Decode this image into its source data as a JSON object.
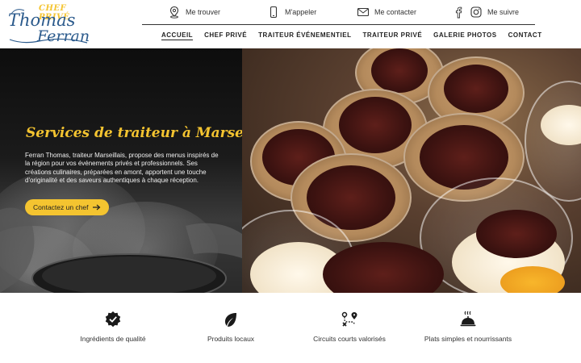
{
  "logo": {
    "top_text": "CHEF PRIVÉ",
    "line1": "Thomas",
    "line2": "Ferran"
  },
  "contact_bar": [
    {
      "label": "Me trouver",
      "icon": "map-pin-icon"
    },
    {
      "label": "M'appeler",
      "icon": "phone-icon"
    },
    {
      "label": "Me contacter",
      "icon": "envelope-icon"
    },
    {
      "label": "Me suivre",
      "icon": "social-icons"
    }
  ],
  "nav": [
    {
      "label": "ACCUEIL",
      "active": true
    },
    {
      "label": "CHEF PRIVÉ",
      "active": false
    },
    {
      "label": "TRAITEUR ÉVÉNEMENTIEL",
      "active": false
    },
    {
      "label": "TRAITEUR PRIVÉ",
      "active": false
    },
    {
      "label": "GALERIE PHOTOS",
      "active": false
    },
    {
      "label": "CONTACT",
      "active": false
    }
  ],
  "hero": {
    "title": "Services de traiteur à Marseille",
    "text": "Ferran Thomas, traiteur Marseillais, propose des menus inspirés de la région pour vos événements privés et professionnels. Ses créations culinaires, préparées en amont, apportent une touche d'originalité et des saveurs authentiques à chaque réception.",
    "button_label": "Contactez un chef",
    "button_icon": "arrow-right-icon"
  },
  "features": [
    {
      "label": "Ingrédients de qualité",
      "icon": "verified-badge-icon"
    },
    {
      "label": "Produits locaux",
      "icon": "leaf-icon"
    },
    {
      "label": "Circuits courts valorisés",
      "icon": "route-icon"
    },
    {
      "label": "Plats simples et nourrissants",
      "icon": "cloche-icon"
    }
  ],
  "colors": {
    "accent": "#f4c430",
    "brand_blue": "#2b5a8c",
    "text_dark": "#222222"
  }
}
